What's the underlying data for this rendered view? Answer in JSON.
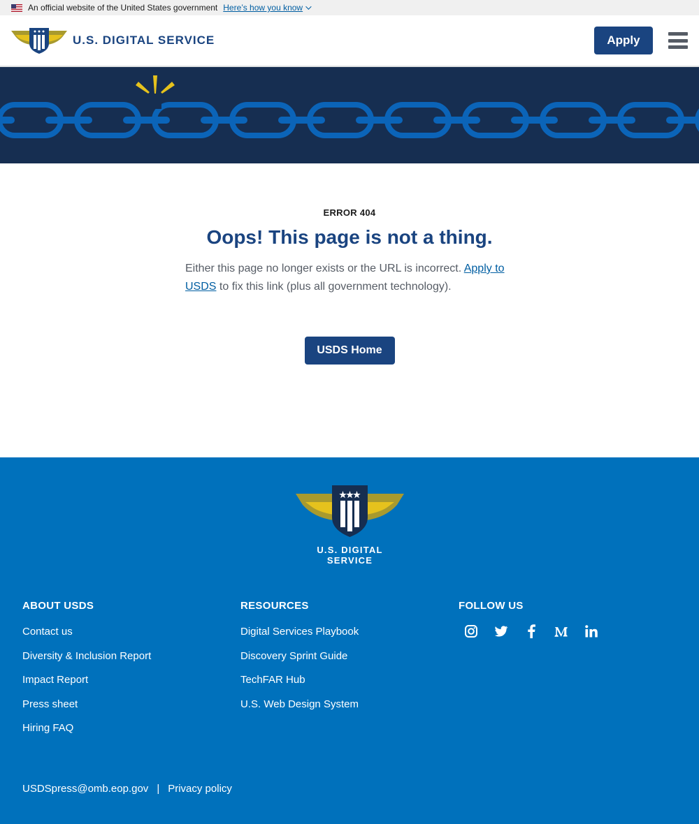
{
  "gov_banner": {
    "text": "An official website of the United States government",
    "link": "Here’s how you know"
  },
  "header": {
    "logo_text": "U.S. DIGITAL SERVICE",
    "apply_label": "Apply"
  },
  "main": {
    "error_code": "ERROR 404",
    "title": "Oops! This page is not a thing.",
    "description_before": "Either this page no longer exists or the URL is incorrect. ",
    "description_link": "Apply to USDS",
    "description_after": " to fix this link (plus all government technology).",
    "home_button": "USDS Home"
  },
  "footer": {
    "logo_text": "U.S. DIGITAL SERVICE",
    "columns": [
      {
        "heading": "ABOUT USDS",
        "links": [
          "Contact us",
          "Diversity & Inclusion Report",
          "Impact Report",
          "Press sheet",
          "Hiring FAQ"
        ]
      },
      {
        "heading": "RESOURCES",
        "links": [
          "Digital Services Playbook",
          "Discovery Sprint Guide",
          "TechFAR Hub",
          "U.S. Web Design System"
        ]
      },
      {
        "heading": "FOLLOW US",
        "social": [
          "instagram-icon",
          "twitter-icon",
          "facebook-icon",
          "medium-icon",
          "linkedin-icon"
        ]
      }
    ],
    "email": "USDSpress@omb.eop.gov",
    "separator": "|",
    "privacy": "Privacy policy"
  },
  "colors": {
    "navy": "#1a4480",
    "hero_bg": "#162e51",
    "chain": "#0b64b8",
    "footer_bg": "#0071bc",
    "gold": "#e5c21d"
  }
}
